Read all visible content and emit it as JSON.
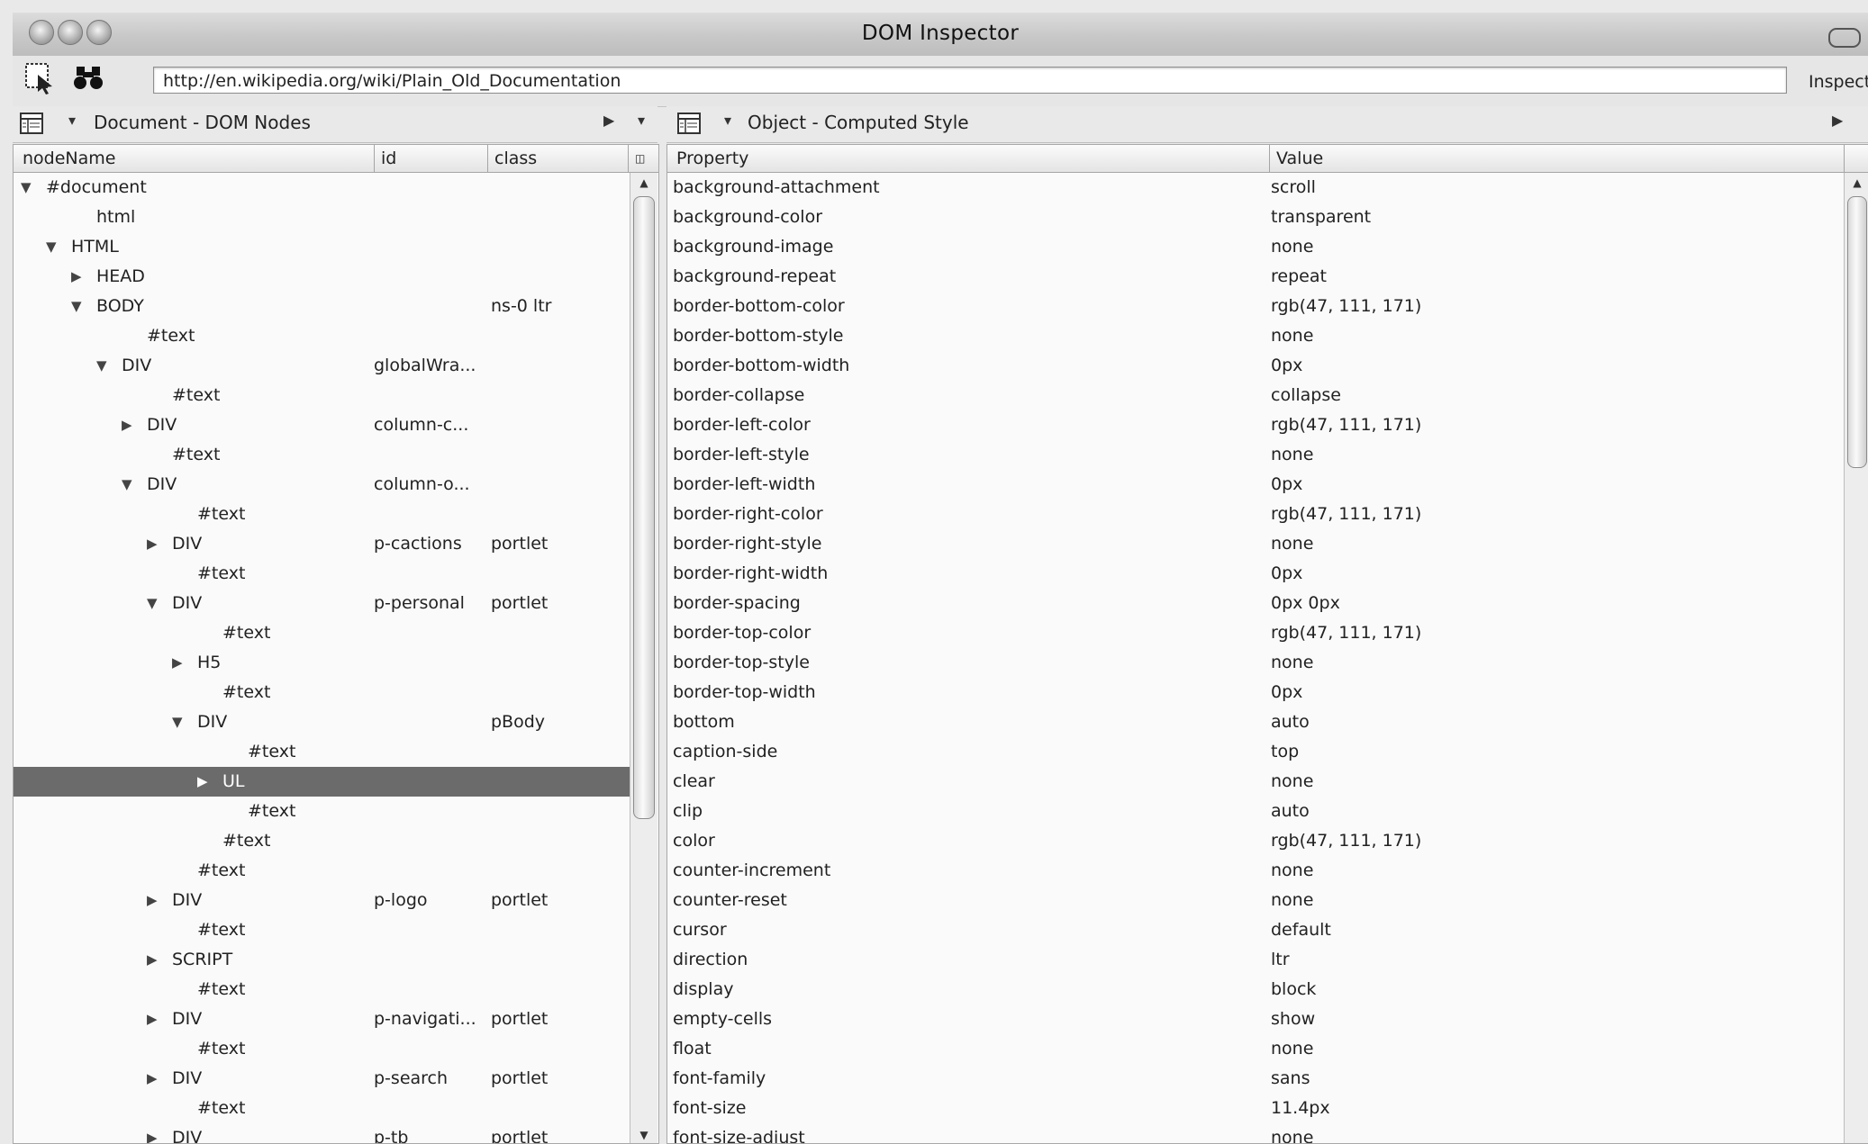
{
  "window": {
    "title": "DOM Inspector"
  },
  "toolbar": {
    "url": "http://en.wikipedia.org/wiki/Plain_Old_Documentation",
    "inspect_label": "Inspect",
    "icons": [
      "select-node-icon",
      "binoculars-icon"
    ]
  },
  "left_panel": {
    "title": "Document - DOM Nodes",
    "columns": {
      "nodeName": "nodeName",
      "id": "id",
      "class": "class"
    },
    "rows": [
      {
        "twisty": "▼",
        "indent": 0,
        "name": "#document",
        "id": "",
        "class": ""
      },
      {
        "twisty": "",
        "indent": 2,
        "name": "html",
        "id": "",
        "class": ""
      },
      {
        "twisty": "▼",
        "indent": 1,
        "name": "HTML",
        "id": "",
        "class": ""
      },
      {
        "twisty": "▶",
        "indent": 2,
        "name": "HEAD",
        "id": "",
        "class": ""
      },
      {
        "twisty": "▼",
        "indent": 2,
        "name": "BODY",
        "id": "",
        "class": "ns-0 ltr"
      },
      {
        "twisty": "",
        "indent": 4,
        "name": "#text",
        "id": "",
        "class": ""
      },
      {
        "twisty": "▼",
        "indent": 3,
        "name": "DIV",
        "id": "globalWra...",
        "class": ""
      },
      {
        "twisty": "",
        "indent": 5,
        "name": "#text",
        "id": "",
        "class": ""
      },
      {
        "twisty": "▶",
        "indent": 4,
        "name": "DIV",
        "id": "column-c...",
        "class": ""
      },
      {
        "twisty": "",
        "indent": 5,
        "name": "#text",
        "id": "",
        "class": ""
      },
      {
        "twisty": "▼",
        "indent": 4,
        "name": "DIV",
        "id": "column-o...",
        "class": ""
      },
      {
        "twisty": "",
        "indent": 6,
        "name": "#text",
        "id": "",
        "class": ""
      },
      {
        "twisty": "▶",
        "indent": 5,
        "name": "DIV",
        "id": "p-cactions",
        "class": "portlet"
      },
      {
        "twisty": "",
        "indent": 6,
        "name": "#text",
        "id": "",
        "class": ""
      },
      {
        "twisty": "▼",
        "indent": 5,
        "name": "DIV",
        "id": "p-personal",
        "class": "portlet"
      },
      {
        "twisty": "",
        "indent": 7,
        "name": "#text",
        "id": "",
        "class": ""
      },
      {
        "twisty": "▶",
        "indent": 6,
        "name": "H5",
        "id": "",
        "class": ""
      },
      {
        "twisty": "",
        "indent": 7,
        "name": "#text",
        "id": "",
        "class": ""
      },
      {
        "twisty": "▼",
        "indent": 6,
        "name": "DIV",
        "id": "",
        "class": "pBody"
      },
      {
        "twisty": "",
        "indent": 8,
        "name": "#text",
        "id": "",
        "class": ""
      },
      {
        "twisty": "▶",
        "indent": 7,
        "name": "UL",
        "id": "",
        "class": "",
        "selected": true
      },
      {
        "twisty": "",
        "indent": 8,
        "name": "#text",
        "id": "",
        "class": ""
      },
      {
        "twisty": "",
        "indent": 7,
        "name": "#text",
        "id": "",
        "class": ""
      },
      {
        "twisty": "",
        "indent": 6,
        "name": "#text",
        "id": "",
        "class": ""
      },
      {
        "twisty": "▶",
        "indent": 5,
        "name": "DIV",
        "id": "p-logo",
        "class": "portlet"
      },
      {
        "twisty": "",
        "indent": 6,
        "name": "#text",
        "id": "",
        "class": ""
      },
      {
        "twisty": "▶",
        "indent": 5,
        "name": "SCRIPT",
        "id": "",
        "class": ""
      },
      {
        "twisty": "",
        "indent": 6,
        "name": "#text",
        "id": "",
        "class": ""
      },
      {
        "twisty": "▶",
        "indent": 5,
        "name": "DIV",
        "id": "p-navigati...",
        "class": "portlet"
      },
      {
        "twisty": "",
        "indent": 6,
        "name": "#text",
        "id": "",
        "class": ""
      },
      {
        "twisty": "▶",
        "indent": 5,
        "name": "DIV",
        "id": "p-search",
        "class": "portlet"
      },
      {
        "twisty": "",
        "indent": 6,
        "name": "#text",
        "id": "",
        "class": ""
      },
      {
        "twisty": "▶",
        "indent": 5,
        "name": "DIV",
        "id": "p-tb",
        "class": "portlet"
      }
    ]
  },
  "right_panel": {
    "title": "Object - Computed Style",
    "columns": {
      "property": "Property",
      "value": "Value"
    },
    "rows": [
      {
        "property": "background-attachment",
        "value": "scroll"
      },
      {
        "property": "background-color",
        "value": "transparent"
      },
      {
        "property": "background-image",
        "value": "none"
      },
      {
        "property": "background-repeat",
        "value": "repeat"
      },
      {
        "property": "border-bottom-color",
        "value": "rgb(47, 111, 171)"
      },
      {
        "property": "border-bottom-style",
        "value": "none"
      },
      {
        "property": "border-bottom-width",
        "value": "0px"
      },
      {
        "property": "border-collapse",
        "value": "collapse"
      },
      {
        "property": "border-left-color",
        "value": "rgb(47, 111, 171)"
      },
      {
        "property": "border-left-style",
        "value": "none"
      },
      {
        "property": "border-left-width",
        "value": "0px"
      },
      {
        "property": "border-right-color",
        "value": "rgb(47, 111, 171)"
      },
      {
        "property": "border-right-style",
        "value": "none"
      },
      {
        "property": "border-right-width",
        "value": "0px"
      },
      {
        "property": "border-spacing",
        "value": "0px 0px"
      },
      {
        "property": "border-top-color",
        "value": "rgb(47, 111, 171)"
      },
      {
        "property": "border-top-style",
        "value": "none"
      },
      {
        "property": "border-top-width",
        "value": "0px"
      },
      {
        "property": "bottom",
        "value": "auto"
      },
      {
        "property": "caption-side",
        "value": "top"
      },
      {
        "property": "clear",
        "value": "none"
      },
      {
        "property": "clip",
        "value": "auto"
      },
      {
        "property": "color",
        "value": "rgb(47, 111, 171)"
      },
      {
        "property": "counter-increment",
        "value": "none"
      },
      {
        "property": "counter-reset",
        "value": "none"
      },
      {
        "property": "cursor",
        "value": "default"
      },
      {
        "property": "direction",
        "value": "ltr"
      },
      {
        "property": "display",
        "value": "block"
      },
      {
        "property": "empty-cells",
        "value": "show"
      },
      {
        "property": "float",
        "value": "none"
      },
      {
        "property": "font-family",
        "value": "sans"
      },
      {
        "property": "font-size",
        "value": "11.4px"
      },
      {
        "property": "font-size-adjust",
        "value": "none"
      }
    ]
  },
  "colors": {
    "selected_row": "#6b6b6b",
    "background": "#e9e9e9"
  }
}
